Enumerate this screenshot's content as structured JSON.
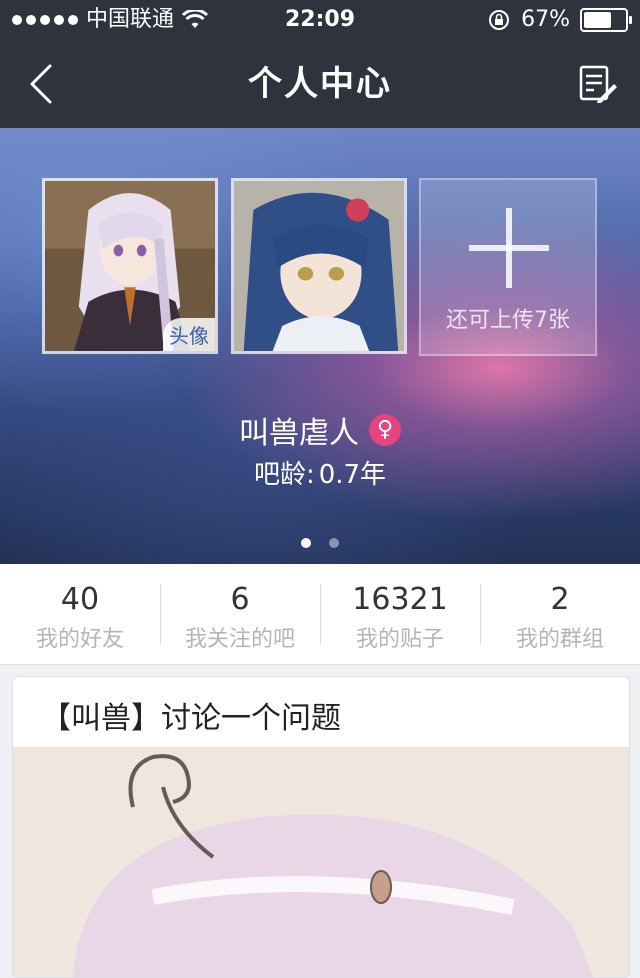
{
  "status_bar": {
    "carrier": "中国联通",
    "time": "22:09",
    "battery_percent": "67%",
    "battery_level": 0.67
  },
  "nav": {
    "title": "个人中心",
    "back_icon": "chevron-left-icon",
    "edit_icon": "edit-note-icon"
  },
  "profile": {
    "photos": [
      {
        "badge": "头像"
      },
      {
        "badge": ""
      }
    ],
    "add_photo_label": "还可上传7张",
    "username": "叫兽虐人",
    "gender_symbol": "♀",
    "ba_age_label": "吧龄:",
    "ba_age_value": "0.7年",
    "pager_total": 2,
    "pager_active": 1
  },
  "stats": [
    {
      "value": "40",
      "label": "我的好友"
    },
    {
      "value": "6",
      "label": "我关注的吧"
    },
    {
      "value": "16321",
      "label": "我的贴子"
    },
    {
      "value": "2",
      "label": "我的群组"
    }
  ],
  "post": {
    "title": "【叫兽】讨论一个问题"
  },
  "colors": {
    "nav_bg": "#2e333d",
    "gender_badge": "#e2457f",
    "avatar_badge_text": "#3b5fae"
  }
}
